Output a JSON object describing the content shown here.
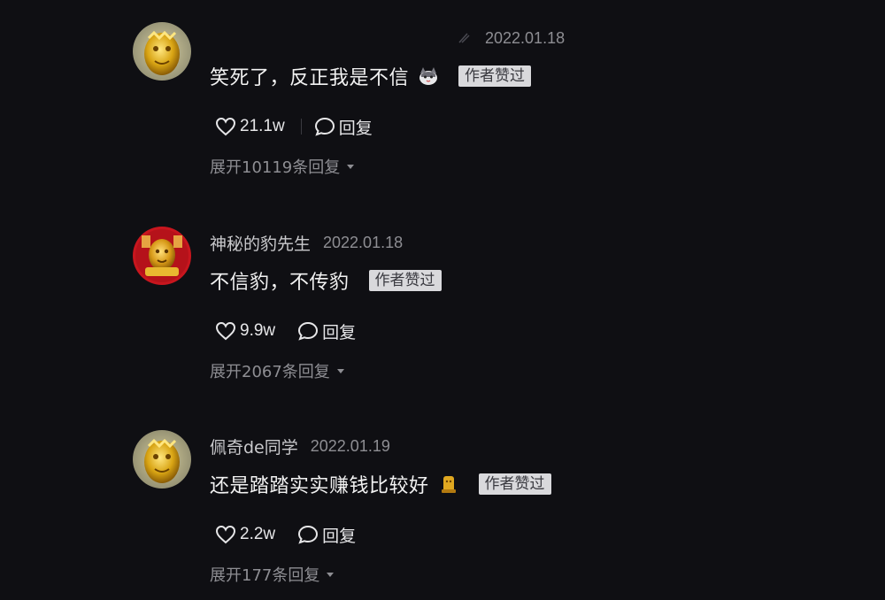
{
  "comments": [
    {
      "username": "",
      "date": "2022.01.18",
      "content": "笑死了，反正我是不信",
      "emoji": "cat-emoji",
      "badge": "作者赞过",
      "likes": "21.1w",
      "reply_label": "回复",
      "expand": "展开10119条回复"
    },
    {
      "username": "神秘的豹先生",
      "date": "2022.01.18",
      "content": "不信豹，不传豹",
      "badge": "作者赞过",
      "likes": "9.9w",
      "reply_label": "回复",
      "expand": "展开2067条回复"
    },
    {
      "username": "佩奇de同学",
      "date": "2022.01.19",
      "content": "还是踏踏实实赚钱比较好",
      "emoji": "gold-statue-emoji",
      "badge": "作者赞过",
      "likes": "2.2w",
      "reply_label": "回复",
      "expand": "展开177条回复"
    }
  ],
  "colors": {
    "background": "#0f0f13",
    "badge_bg": "#d9d9dc",
    "secondary_text": "#8e8e93"
  }
}
